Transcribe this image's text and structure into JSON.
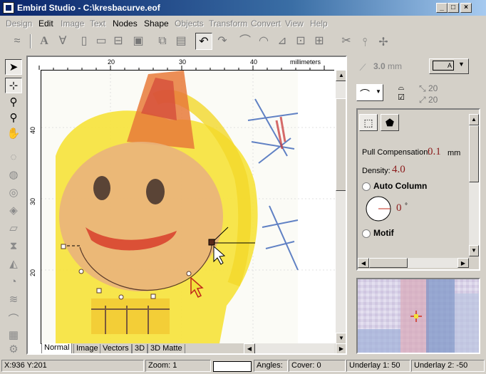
{
  "window": {
    "title": "Embird Studio - C:\\kresbacurve.eof",
    "min_glyph": "_",
    "max_glyph": "□",
    "close_glyph": "×"
  },
  "menu": [
    {
      "label": "Design",
      "enabled": false
    },
    {
      "label": "Edit",
      "enabled": true
    },
    {
      "label": "Image",
      "enabled": false
    },
    {
      "label": "Text",
      "enabled": false
    },
    {
      "label": "Nodes",
      "enabled": true
    },
    {
      "label": "Shape",
      "enabled": true
    },
    {
      "label": "Objects",
      "enabled": false
    },
    {
      "label": "Transform",
      "enabled": false
    },
    {
      "label": "Convert",
      "enabled": false
    },
    {
      "label": "View",
      "enabled": false
    },
    {
      "label": "Help",
      "enabled": false
    }
  ],
  "ruler": {
    "unit_label": "millimeters",
    "h_ticks": [
      "20",
      "30",
      "40"
    ],
    "v_ticks": [
      "40",
      "30",
      "20"
    ]
  },
  "tabs": [
    "Normal",
    "Image",
    "Vectors",
    "3D",
    "3D Matte"
  ],
  "active_tab": "Normal",
  "right_panel": {
    "spacing_value": "3.0",
    "spacing_unit": "mm",
    "stitch_type_label": "A",
    "angle_top": "20",
    "angle_bottom": "20",
    "pull_comp_label": "Pull Compensation:",
    "pull_comp_value": "0.1",
    "pull_comp_unit": "mm",
    "density_label": "Density:",
    "density_value": "4.0",
    "auto_column_label": "Auto Column",
    "angle_value": "0",
    "angle_unit": "°",
    "motif_label": "Motif"
  },
  "status": {
    "coords": "X:936  Y:201",
    "zoom": "Zoom: 1",
    "angles": "Angles:",
    "cover": "Cover: 0",
    "underlay1": "Underlay 1: 50",
    "underlay2": "Underlay 2: -50"
  },
  "colors": {
    "title_gradient_start": "#0a246a",
    "title_gradient_end": "#a6caf0",
    "density_red": "#8b1a1a"
  }
}
